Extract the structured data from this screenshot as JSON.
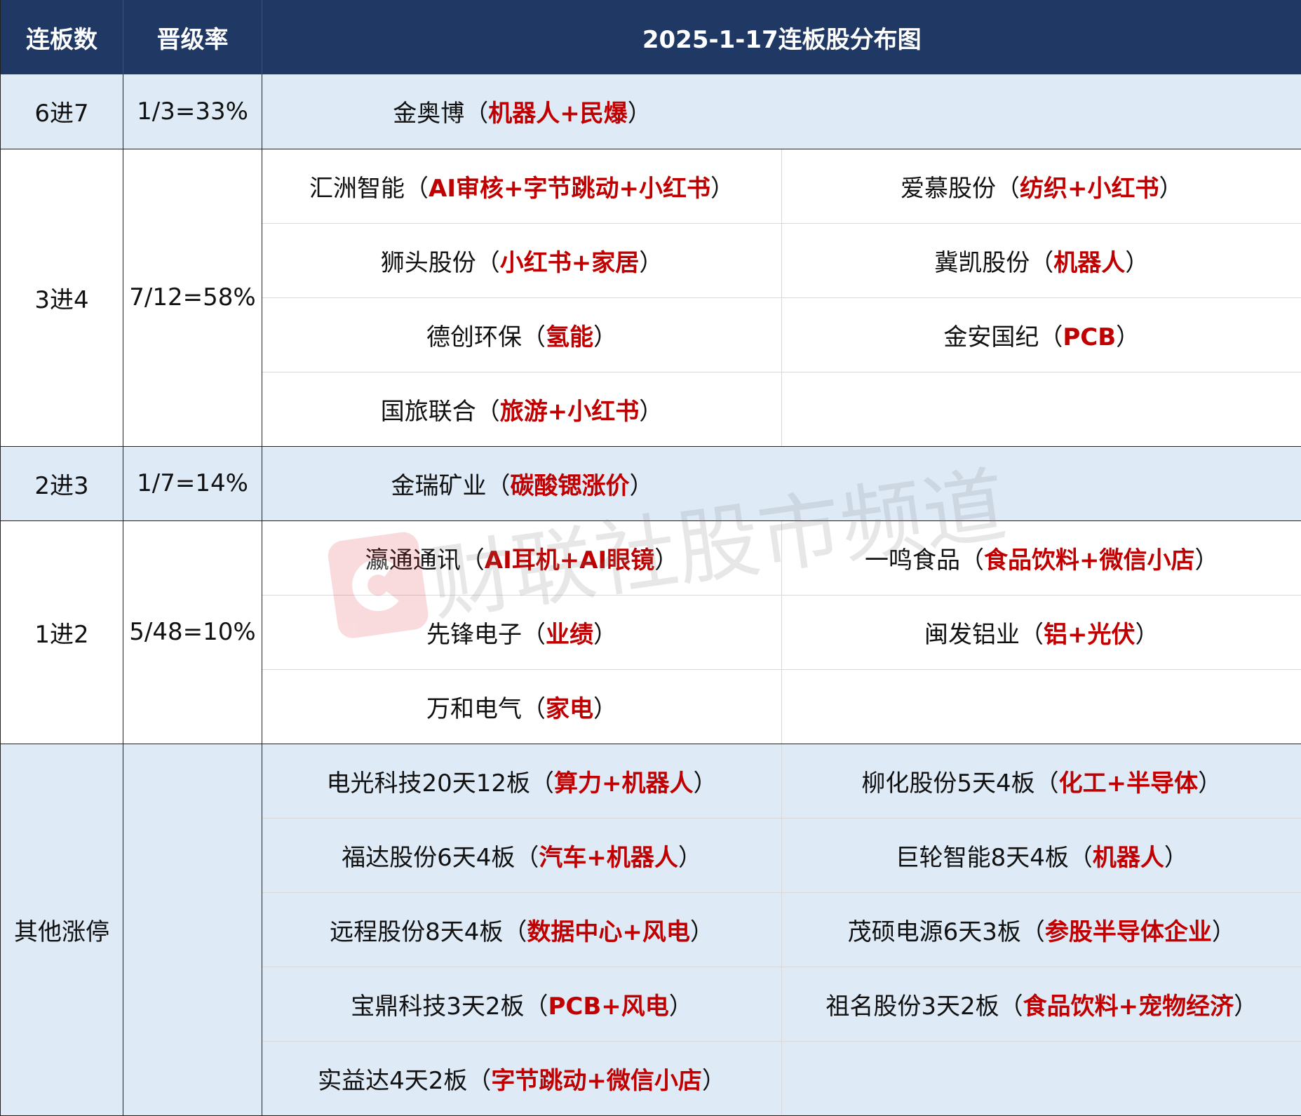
{
  "header": {
    "col_level": "连板数",
    "col_rate": "晋级率",
    "col_title": "2025-1-17连板股分布图"
  },
  "groups": [
    {
      "level": "6进7",
      "rate": "1/3=33%",
      "stocks": [
        {
          "name": "金奥博",
          "theme": "机器人+民爆"
        }
      ]
    },
    {
      "level": "3进4",
      "rate": "7/12=58%",
      "stocks": [
        {
          "name": "汇洲智能",
          "theme": "AI审核+字节跳动+小红书"
        },
        {
          "name": "爱慕股份",
          "theme": "纺织+小红书"
        },
        {
          "name": "狮头股份",
          "theme": "小红书+家居"
        },
        {
          "name": "冀凯股份",
          "theme": "机器人"
        },
        {
          "name": "德创环保",
          "theme": "氢能"
        },
        {
          "name": "金安国纪",
          "theme": "PCB"
        },
        {
          "name": "国旅联合",
          "theme": "旅游+小红书"
        }
      ]
    },
    {
      "level": "2进3",
      "rate": "1/7=14%",
      "stocks": [
        {
          "name": "金瑞矿业",
          "theme": "碳酸锶涨价"
        }
      ]
    },
    {
      "level": "1进2",
      "rate": "5/48=10%",
      "stocks": [
        {
          "name": "瀛通通讯",
          "theme": "AI耳机+AI眼镜"
        },
        {
          "name": "一鸣食品",
          "theme": "食品饮料+微信小店"
        },
        {
          "name": "先锋电子",
          "theme": "业绩"
        },
        {
          "name": "闽发铝业",
          "theme": "铝+光伏"
        },
        {
          "name": "万和电气",
          "theme": "家电"
        }
      ]
    },
    {
      "level": "其他涨停",
      "rate": "",
      "stocks": [
        {
          "name": "电光科技20天12板",
          "theme": "算力+机器人"
        },
        {
          "name": "柳化股份5天4板",
          "theme": "化工+半导体"
        },
        {
          "name": "福达股份6天4板",
          "theme": "汽车+机器人"
        },
        {
          "name": "巨轮智能8天4板",
          "theme": "机器人"
        },
        {
          "name": "远程股份8天4板",
          "theme": "数据中心+风电"
        },
        {
          "name": "茂硕电源6天3板",
          "theme": "参股半导体企业"
        },
        {
          "name": "宝鼎科技3天2板",
          "theme": "PCB+风电"
        },
        {
          "name": "祖名股份3天2板",
          "theme": "食品饮料+宠物经济"
        },
        {
          "name": "实益达4天2板",
          "theme": "字节跳动+微信小店"
        }
      ]
    }
  ],
  "watermark": {
    "text": "财联社股市频道",
    "logo_letter": "C"
  },
  "colors": {
    "header_bg": "#1f3864",
    "band_blue": "#deebf7",
    "theme_red": "#c00000",
    "logo_red": "#e0303a"
  }
}
